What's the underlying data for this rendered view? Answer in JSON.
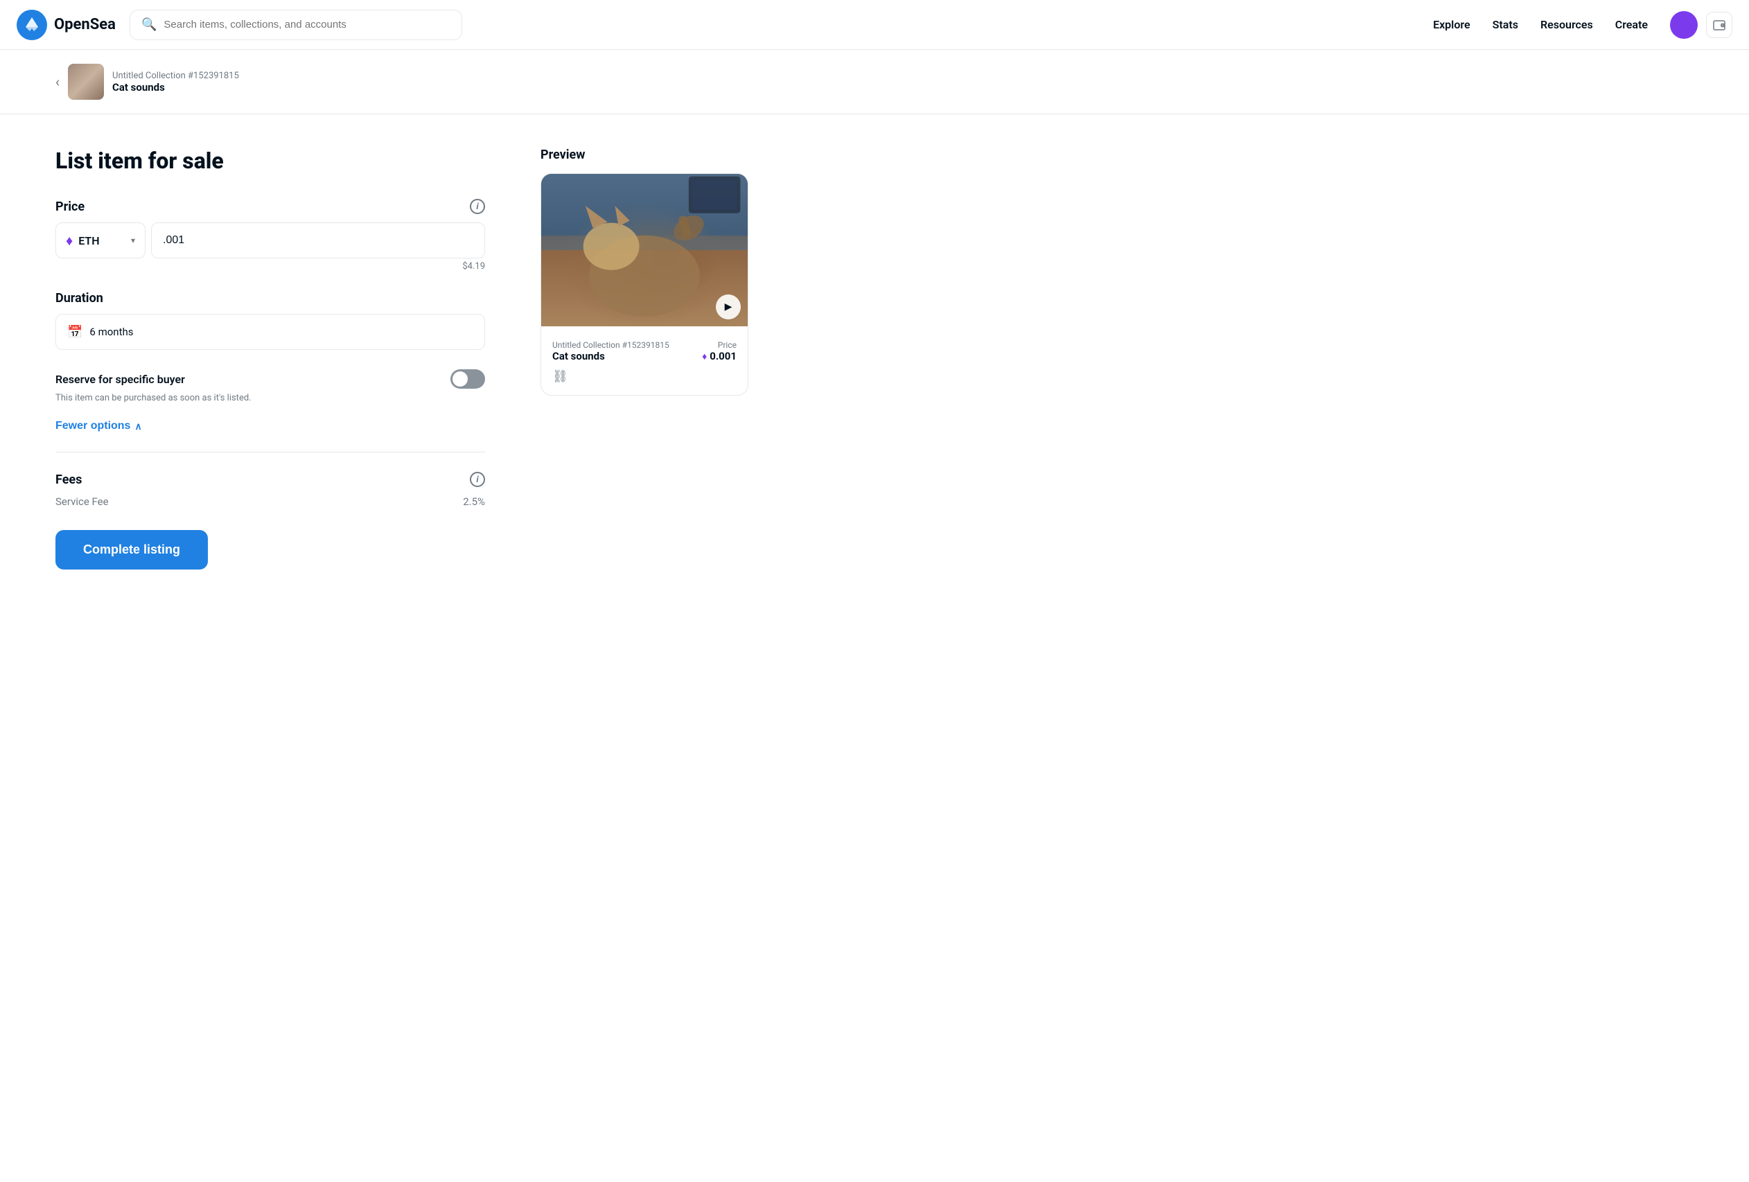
{
  "navbar": {
    "logo_text": "OpenSea",
    "search_placeholder": "Search items, collections, and accounts",
    "links": [
      "Explore",
      "Stats",
      "Resources",
      "Create"
    ]
  },
  "breadcrumb": {
    "collection_id": "Untitled Collection #152391815",
    "item_name": "Cat sounds"
  },
  "form": {
    "page_title": "List item for sale",
    "price": {
      "label": "Price",
      "currency": "ETH",
      "amount": ".001",
      "usd_value": "$4.19"
    },
    "duration": {
      "label": "Duration",
      "value": "6 months"
    },
    "reserve": {
      "label": "Reserve for specific buyer",
      "description": "This item can be purchased as soon as it's listed."
    },
    "fewer_options": "Fewer options",
    "fees": {
      "label": "Fees",
      "service_fee_label": "Service Fee",
      "service_fee_value": "2.5%"
    },
    "complete_button": "Complete listing"
  },
  "preview": {
    "label": "Preview",
    "collection": "Untitled Collection #152391815",
    "name": "Cat sounds",
    "price_label": "Price",
    "price_value": "0.001"
  }
}
